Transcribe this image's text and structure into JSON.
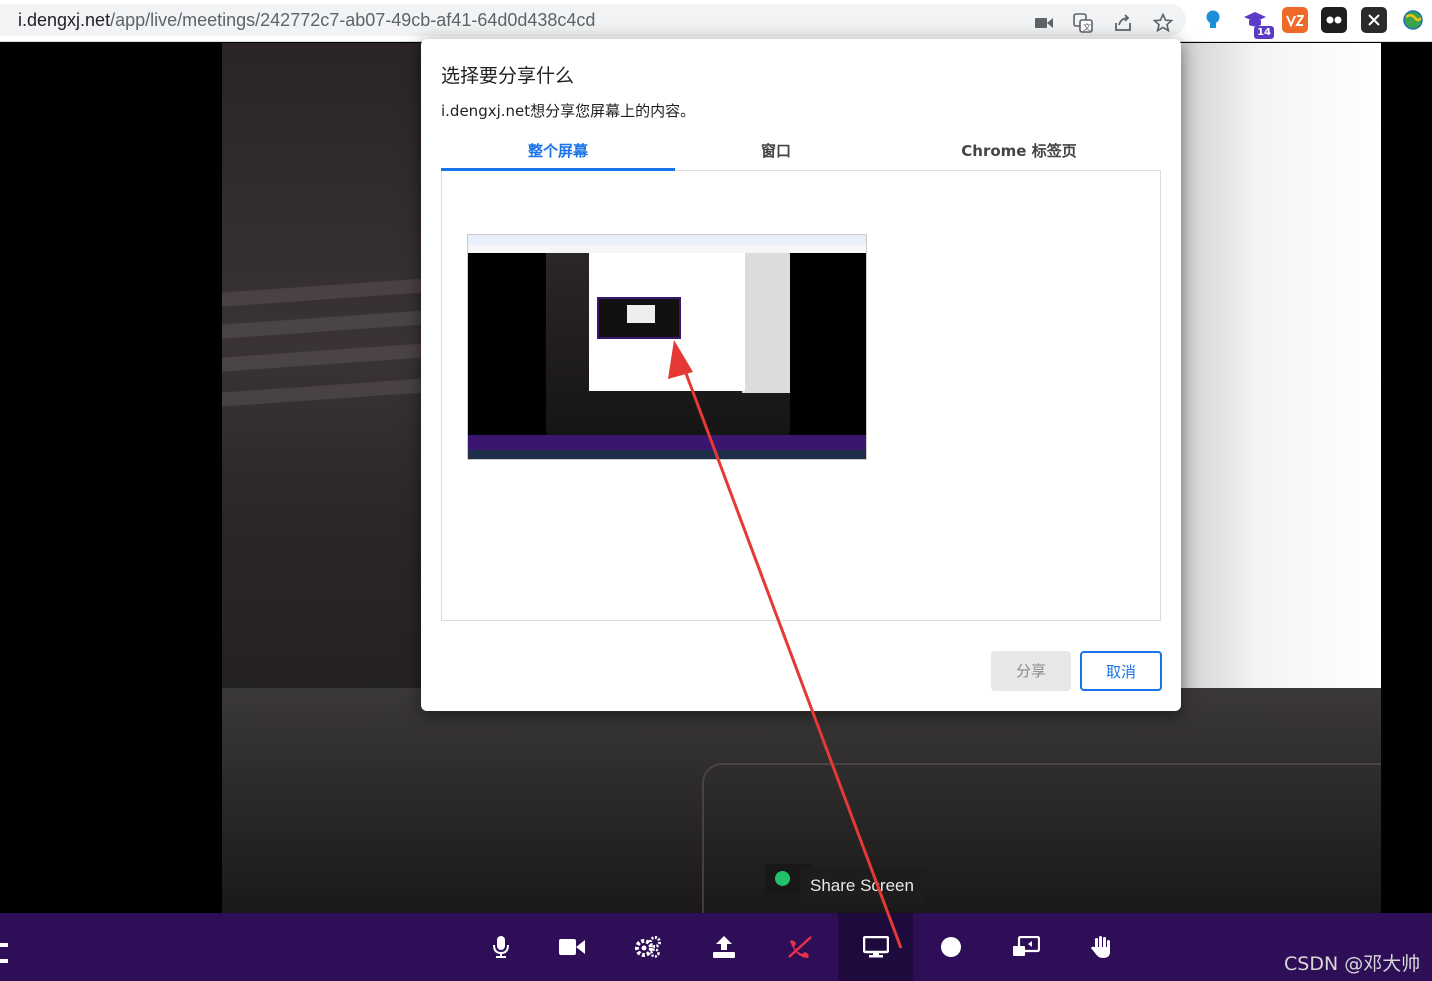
{
  "browser": {
    "url_host": "i.dengxj.net",
    "url_path": "/app/live/meetings/242772c7-ab07-49cb-af41-64d0d438c4cd",
    "icons": [
      "camera-icon",
      "translate-icon",
      "share-icon",
      "star-icon"
    ],
    "extensions": [
      {
        "name": "bulb-extension-icon",
        "color": "#1a8fd8"
      },
      {
        "name": "graduation-extension-icon",
        "color": "#5b3cc4",
        "badge": "14"
      },
      {
        "name": "orange-extension-icon",
        "color": "#ef6a28"
      },
      {
        "name": "dark-extension-icon",
        "color": "#1e1e1e"
      },
      {
        "name": "x-extension-icon",
        "color": "#2b2b2b"
      },
      {
        "name": "globe-extension-icon",
        "color": "#3aa24a"
      }
    ]
  },
  "dialog": {
    "title": "选择要分享什么",
    "subtitle": "i.dengxj.net想分享您屏幕上的内容。",
    "tabs": [
      {
        "label": "整个屏幕",
        "active": true
      },
      {
        "label": "窗口",
        "active": false
      },
      {
        "label": "Chrome 标签页",
        "active": false
      }
    ],
    "share_label": "分享",
    "cancel_label": "取消"
  },
  "controls": {
    "tooltip": "Share Screen",
    "buttons": [
      "microphone-icon",
      "camera-icon",
      "settings-icon",
      "upload-icon",
      "hangup-icon",
      "share-screen-icon",
      "record-icon",
      "cast-icon",
      "raise-hand-icon"
    ],
    "active": "share-screen-icon",
    "accent_color": "#2e0f57",
    "hangup_color": "#e8304a"
  },
  "watermark": "CSDN @邓大帅"
}
